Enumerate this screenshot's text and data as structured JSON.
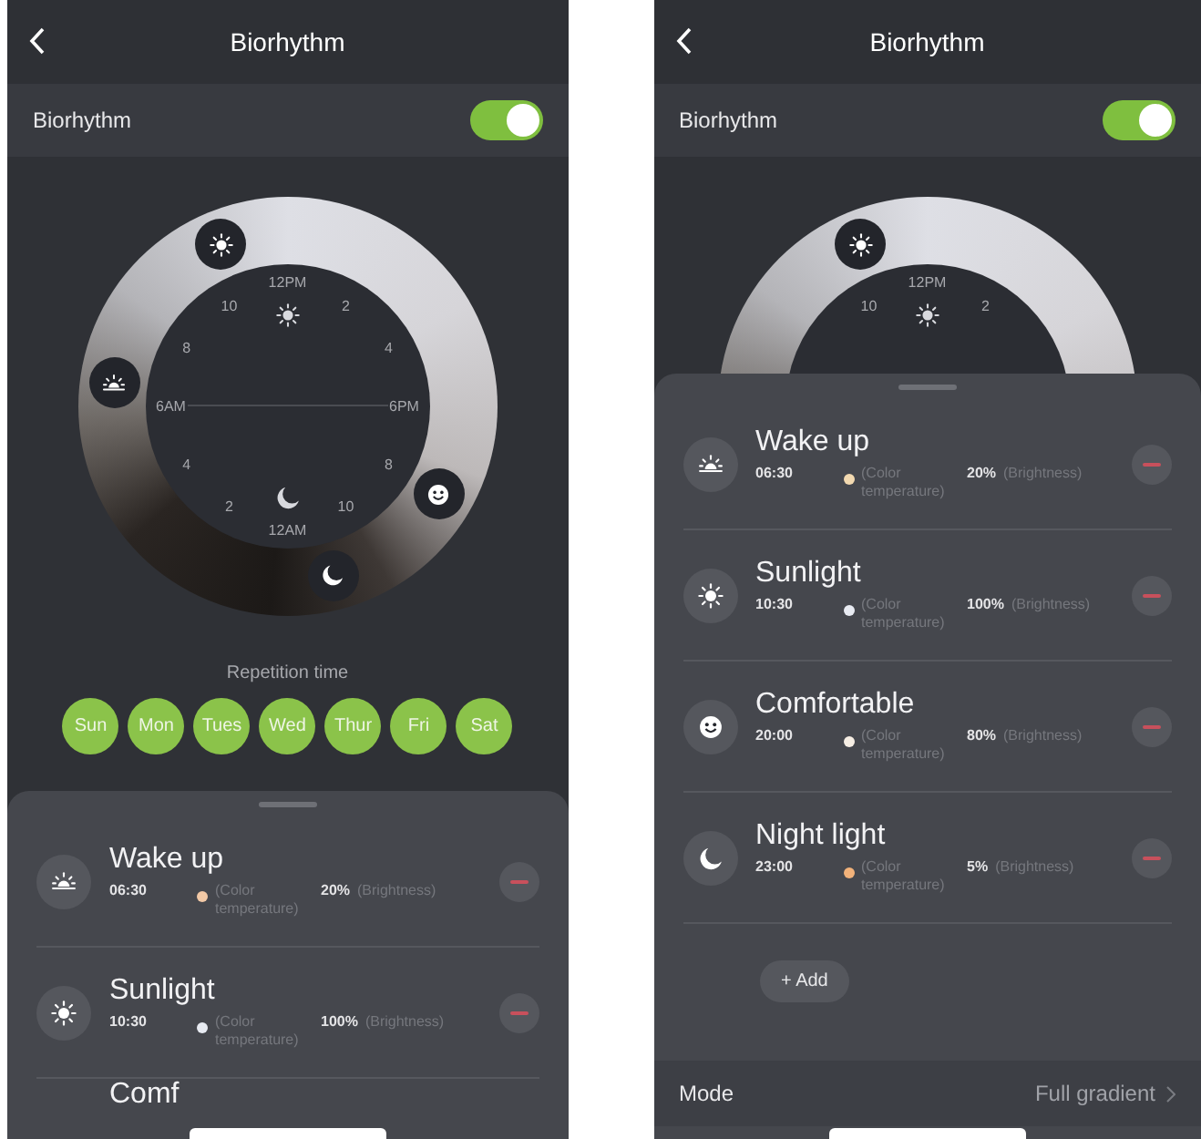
{
  "screens": [
    {
      "title": "Biorhythm",
      "toggle": {
        "label": "Biorhythm",
        "on": true
      },
      "dial": {
        "hours": [
          {
            "kind": "n",
            "label": "12PM"
          },
          {
            "kind": "nne",
            "label": "2"
          },
          {
            "kind": "ene",
            "label": "4"
          },
          {
            "kind": "e",
            "label": "6PM"
          },
          {
            "kind": "ese",
            "label": "8"
          },
          {
            "kind": "sse",
            "label": "10"
          },
          {
            "kind": "s",
            "label": "12AM"
          },
          {
            "kind": "ssw",
            "label": "2"
          },
          {
            "kind": "wsw",
            "label": "4"
          },
          {
            "kind": "w",
            "label": "6AM"
          },
          {
            "kind": "wnw",
            "label": "8"
          },
          {
            "kind": "nnw",
            "label": "10"
          }
        ],
        "markers": [
          {
            "kind": "sun"
          },
          {
            "kind": "sunrise"
          },
          {
            "kind": "smile"
          },
          {
            "kind": "moon"
          }
        ]
      },
      "repetition": {
        "label": "Repetition time",
        "days": [
          {
            "label": "Sun",
            "selected": true
          },
          {
            "label": "Mon",
            "selected": true
          },
          {
            "label": "Tues",
            "selected": true
          },
          {
            "label": "Wed",
            "selected": true
          },
          {
            "label": "Thur",
            "selected": true
          },
          {
            "label": "Fri",
            "selected": true
          },
          {
            "label": "Sat",
            "selected": true
          }
        ]
      },
      "schedule": [
        {
          "kind": "sunrise",
          "title": "Wake up",
          "time": "06:30",
          "color": "#f2c9a6",
          "temperature": "(Color temperature)",
          "brightness": "20%",
          "brightness_label": "(Brightness)"
        },
        {
          "kind": "sun",
          "title": "Sunlight",
          "time": "10:30",
          "color": "#e8ebf2",
          "temperature": "(Color temperature)",
          "brightness": "100%",
          "brightness_label": "(Brightness)"
        },
        {
          "title": "Comf"
        }
      ]
    },
    {
      "title": "Biorhythm",
      "toggle": {
        "label": "Biorhythm",
        "on": true
      },
      "dial": {
        "hours": [
          {
            "kind": "n",
            "label": "12PM"
          },
          {
            "kind": "nne",
            "label": "2"
          },
          {
            "kind": "nnw",
            "label": "10"
          }
        ],
        "markers": [
          {
            "kind": "sun"
          }
        ]
      },
      "schedule": [
        {
          "kind": "sunrise",
          "title": "Wake up",
          "time": "06:30",
          "color": "#f2d9b0",
          "temperature": "(Color temperature)",
          "brightness": "20%",
          "brightness_label": "(Brightness)"
        },
        {
          "kind": "sun",
          "title": "Sunlight",
          "time": "10:30",
          "color": "#e8ebf2",
          "temperature": "(Color temperature)",
          "brightness": "100%",
          "brightness_label": "(Brightness)"
        },
        {
          "kind": "smile",
          "title": "Comfortable",
          "time": "20:00",
          "color": "#f6eee4",
          "temperature": "(Color temperature)",
          "brightness": "80%",
          "brightness_label": "(Brightness)"
        },
        {
          "kind": "moon",
          "title": "Night light",
          "time": "23:00",
          "color": "#f2b27a",
          "temperature": "(Color temperature)",
          "brightness": "5%",
          "brightness_label": "(Brightness)"
        }
      ],
      "add_button": "+ Add",
      "mode": {
        "label": "Mode",
        "value": "Full gradient"
      }
    }
  ]
}
